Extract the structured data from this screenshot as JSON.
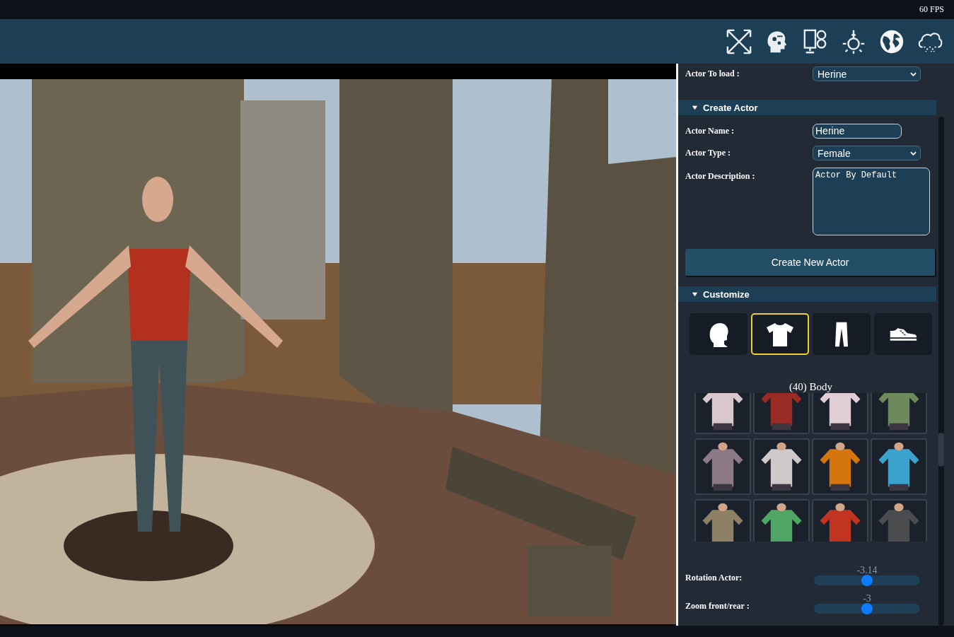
{
  "top_bar": {
    "fps": "60 FPS"
  },
  "panel": {
    "actor_to_load": {
      "label": "Actor To load :",
      "value": "Herine"
    },
    "sections": [
      {
        "title": "Create Actor",
        "expanded": true
      },
      {
        "title": "Customize",
        "expanded": true
      }
    ],
    "actor_name": {
      "label": "Actor Name :",
      "value": "Herine"
    },
    "actor_type": {
      "label": "Actor Type :",
      "value": "Female"
    },
    "actor_description": {
      "label": "Actor Description :",
      "value": "Actor By Default"
    },
    "create_button": "Create New Actor",
    "customize_tabs": [
      {
        "kind": "head",
        "selected": false
      },
      {
        "kind": "shirt",
        "selected": true
      },
      {
        "kind": "pants",
        "selected": false
      },
      {
        "kind": "shoe",
        "selected": false
      }
    ],
    "category_title": "(40) Body",
    "sliders": [
      {
        "label": "Rotation Actor:",
        "reading": "-3.14",
        "level": 0.5
      },
      {
        "label": "Zoom front/rear :",
        "reading": "-3",
        "level": 0.5
      }
    ]
  }
}
